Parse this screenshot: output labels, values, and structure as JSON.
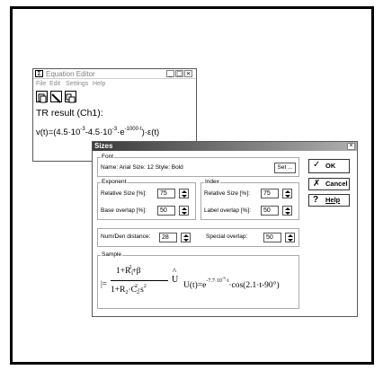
{
  "equation_editor": {
    "title": "Equation Editor",
    "icon_glyph": "Σ",
    "controls": {
      "minimize": "_",
      "maximize": "□",
      "close": "×"
    },
    "menu": [
      "File",
      "Edit",
      "Settings",
      "Help"
    ],
    "toolbar_icons": [
      "document-icon",
      "pen-icon",
      "copy-icon"
    ],
    "result_label": "TR result (Ch1):",
    "result_expr": {
      "p1": "v(t)=(4.5·10",
      "e1": "-3",
      "p2": "-4.5·10",
      "e2": "-3",
      "p3": "·e",
      "e3": "-1000·t",
      "p4": ")·ε(t)"
    }
  },
  "sizes_dialog": {
    "title": "Sizes",
    "close": "×",
    "font_group": {
      "legend": "Font",
      "name_label": "Name: Arial Size: 12 Style: Bold",
      "set_button": "Set ..."
    },
    "exponent_group": {
      "legend": "Exponent",
      "relative_size_label": "Relative Size [%]:",
      "relative_size_value": "75",
      "base_overlap_label": "Base overlap [%]:",
      "base_overlap_value": "50"
    },
    "index_group": {
      "legend": "Index",
      "relative_size_label": "Relative Size [%]:",
      "relative_size_value": "75",
      "label_overlap_label": "Label overlap [%]:",
      "label_overlap_value": "50"
    },
    "numden_label": "Num/Den distance:",
    "numden_value": "28",
    "special_overlap_label": "Special overlap:",
    "special_overlap_value": "50",
    "sample_group": {
      "legend": "Sample",
      "num": "1+R",
      "num_sub": "1",
      "num_sup": "2",
      "num_tail": "+β",
      "den": "1+R",
      "den_sub": "2",
      "den_mid": "·C",
      "den_sub2": "2",
      "den_sup2": "2",
      "den_tail": "·s",
      "den_sup3": "2",
      "hat_char": "U",
      "hat_mark": "^",
      "expr_head": "U(t)=e",
      "expr_sup": "-7.7·10",
      "expr_sup2": "-3",
      "expr_sup3": "·t",
      "expr_tail": "·cos(2.1·t-90°)",
      "prefix": "|="
    },
    "buttons": {
      "ok": "OK",
      "ok_icon": "✓",
      "cancel": "Cancel",
      "cancel_icon": "✗",
      "help": "Help",
      "help_icon": "?"
    }
  }
}
